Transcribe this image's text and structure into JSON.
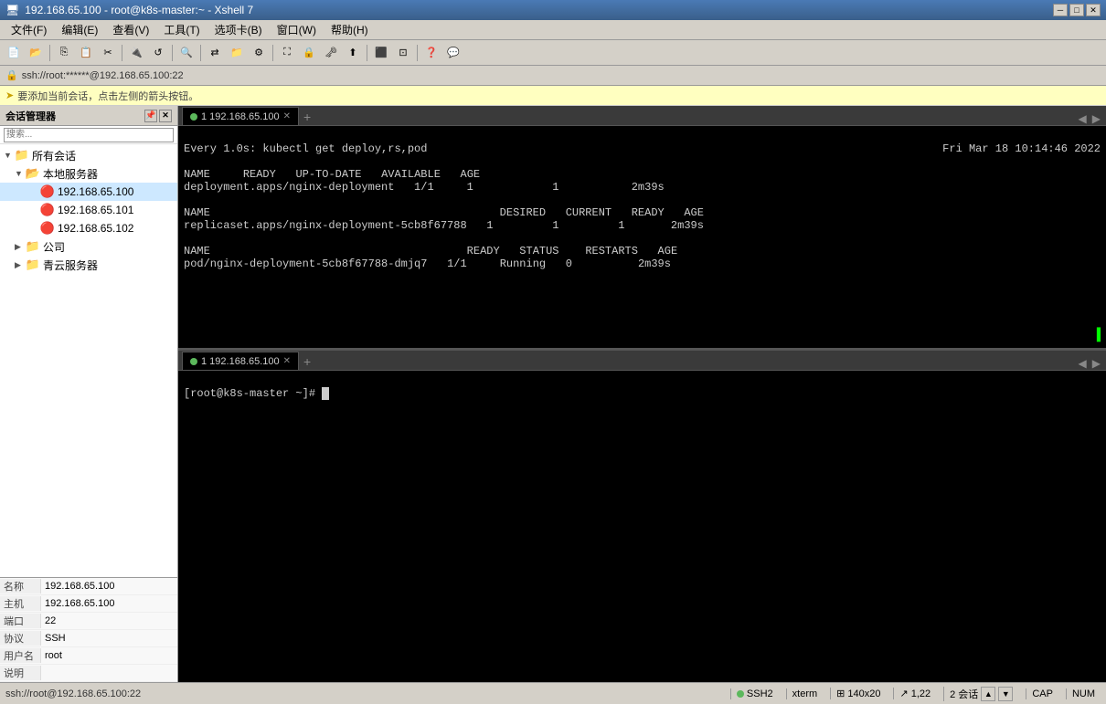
{
  "titlebar": {
    "icon": "🖥",
    "title": "192.168.65.100 - root@k8s-master:~ - Xshell 7",
    "minimize": "─",
    "maximize": "□",
    "close": "✕"
  },
  "menubar": {
    "items": [
      "文件(F)",
      "编辑(E)",
      "查看(V)",
      "工具(T)",
      "选项卡(B)",
      "窗口(W)",
      "帮助(H)"
    ]
  },
  "sshbar": {
    "address": "ssh://root:******@192.168.65.100:22"
  },
  "hintbar": {
    "text": "要添加当前会话，点击左侧的箭头按钮。"
  },
  "sidebar": {
    "title": "会话管理器",
    "all_sessions": "所有会话",
    "local_servers": "本地服务器",
    "servers": [
      {
        "ip": "192.168.65.100",
        "selected": true
      },
      {
        "ip": "192.168.65.101"
      },
      {
        "ip": "192.168.65.102"
      }
    ],
    "company": "公司",
    "qingyun": "青云服务器"
  },
  "info": {
    "name_label": "名称",
    "name_value": "192.168.65.100",
    "host_label": "主机",
    "host_value": "192.168.65.100",
    "port_label": "端口",
    "port_value": "22",
    "protocol_label": "协议",
    "protocol_value": "SSH",
    "username_label": "用户名",
    "username_value": "root",
    "note_label": "说明",
    "note_value": ""
  },
  "upper_terminal": {
    "tab_label": "1 192.168.65.100",
    "content_line1": "Every 1.0s: kubectl get deploy,rs,pod",
    "timestamp": "Fri Mar 18 10:14:46 2022",
    "header1_name": "NAME",
    "header1_ready": "READY",
    "header1_uptodate": "UP-TO-DATE",
    "header1_available": "AVAILABLE",
    "header1_age": "AGE",
    "row1_name": "deployment.apps/nginx-deployment",
    "row1_ready": "1/1",
    "row1_uptodate": "1",
    "row1_available": "1",
    "row1_age": "2m39s",
    "header2_name": "NAME",
    "header2_desired": "DESIRED",
    "header2_current": "CURRENT",
    "header2_ready": "READY",
    "header2_age": "AGE",
    "row2_name": "replicaset.apps/nginx-deployment-5cb8f67788",
    "row2_desired": "1",
    "row2_current": "1",
    "row2_ready": "1",
    "row2_age": "2m39s",
    "header3_name": "NAME",
    "header3_ready": "READY",
    "header3_status": "STATUS",
    "header3_restarts": "RESTARTS",
    "header3_age": "AGE",
    "row3_name": "pod/nginx-deployment-5cb8f67788-dmjq7",
    "row3_ready": "1/1",
    "row3_status": "Running",
    "row3_restarts": "0",
    "row3_age": "2m39s"
  },
  "lower_terminal": {
    "tab_label": "1 192.168.65.100",
    "prompt": "[root@k8s-master ~]# "
  },
  "statusbar": {
    "ssh_address": "ssh://root@192.168.65.100:22",
    "protocol": "SSH2",
    "terminal": "xterm",
    "size_icon": "⊞",
    "size": "140x20",
    "position_icon": "↗",
    "position": "1,22",
    "sessions": "2 会话",
    "caps": "CAP",
    "num": "NUM",
    "nav_up": "▲",
    "nav_down": "▼"
  }
}
